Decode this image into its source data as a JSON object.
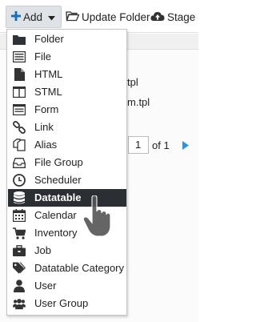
{
  "toolbar": {
    "add_label": "Add",
    "update_folder_label": "Update Folder",
    "stage_label": "Stage"
  },
  "background": {
    "row1_text": "tpl",
    "row2_text": "m.tpl",
    "page_input": "1",
    "page_of": "of 1"
  },
  "menu": {
    "items": [
      {
        "label": "Folder",
        "icon": "folder-icon"
      },
      {
        "label": "File",
        "icon": "file-list-icon"
      },
      {
        "label": "HTML",
        "icon": "document-icon"
      },
      {
        "label": "STML",
        "icon": "columns-icon"
      },
      {
        "label": "Form",
        "icon": "form-icon"
      },
      {
        "label": "Link",
        "icon": "chain-link-icon"
      },
      {
        "label": "Alias",
        "icon": "copy-icon"
      },
      {
        "label": "File Group",
        "icon": "inbox-icon"
      },
      {
        "label": "Scheduler",
        "icon": "clock-icon"
      },
      {
        "label": "Datatable",
        "icon": "database-icon"
      },
      {
        "label": "Calendar",
        "icon": "calendar-icon"
      },
      {
        "label": "Inventory",
        "icon": "cart-icon"
      },
      {
        "label": "Job",
        "icon": "briefcase-icon"
      },
      {
        "label": "Datatable Category G",
        "icon": "tags-icon"
      },
      {
        "label": "User",
        "icon": "user-icon"
      },
      {
        "label": "User Group",
        "icon": "users-icon"
      }
    ],
    "active_label": "Datatable"
  },
  "colors": {
    "accent_blue": "#1f6fb5",
    "menu_active_bg": "#2b2f33",
    "icon_dark": "#333333"
  }
}
